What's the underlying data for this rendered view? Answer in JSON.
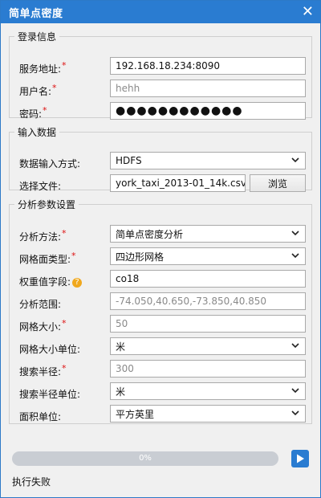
{
  "window": {
    "title": "简单点密度"
  },
  "login": {
    "legend": "登录信息",
    "service_label": "服务地址:",
    "service_value": "192.168.18.234:8090",
    "username_label": "用户名:",
    "username_value": "hehh",
    "password_label": "密码:",
    "password_value": "●●●●●●●●●●●●"
  },
  "input_data": {
    "legend": "输入数据",
    "method_label": "数据输入方式:",
    "method_value": "HDFS",
    "file_label": "选择文件:",
    "file_value": "york_taxi_2013-01_14k.csv",
    "browse_label": "浏览"
  },
  "analysis": {
    "legend": "分析参数设置",
    "method_label": "分析方法:",
    "method_value": "简单点密度分析",
    "mesh_type_label": "网格面类型:",
    "mesh_type_value": "四边形网格",
    "weight_label": "权重值字段:",
    "weight_value": "co18",
    "range_label": "分析范围:",
    "range_value": "-74.050,40.650,-73.850,40.850",
    "grid_size_label": "网格大小:",
    "grid_size_value": "50",
    "grid_unit_label": "网格大小单位:",
    "grid_unit_value": "米",
    "radius_label": "搜索半径:",
    "radius_value": "300",
    "radius_unit_label": "搜索半径单位:",
    "radius_unit_value": "米",
    "area_unit_label": "面积单位:",
    "area_unit_value": "平方英里"
  },
  "progress": {
    "percent_text": "0%",
    "value": 0
  },
  "status": {
    "text": "执行失败"
  },
  "colors": {
    "accent": "#2a7cd1",
    "required": "#dd1111",
    "help": "#f0a81e"
  },
  "icons": {
    "close": "close-icon",
    "dropdown": "chevron-down-icon",
    "help": "help-icon",
    "run": "play-icon"
  }
}
